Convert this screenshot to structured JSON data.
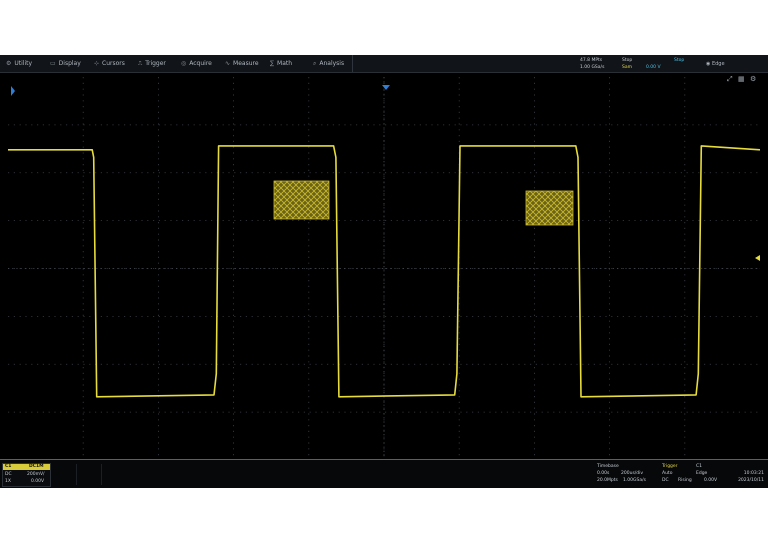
{
  "menu": {
    "items": [
      {
        "name": "menu-utility",
        "icon": "wrench-icon",
        "glyph": "⚙",
        "label": "Utility"
      },
      {
        "name": "menu-display",
        "icon": "display-icon",
        "glyph": "▭",
        "label": "Display"
      },
      {
        "name": "menu-cursors",
        "icon": "cursor-icon",
        "glyph": "⊹",
        "label": "Cursors"
      },
      {
        "name": "menu-trigger",
        "icon": "trigger-icon",
        "glyph": "⎍",
        "label": "Trigger"
      },
      {
        "name": "menu-acquire",
        "icon": "acquire-icon",
        "glyph": "◎",
        "label": "Acquire"
      },
      {
        "name": "menu-measure",
        "icon": "measure-icon",
        "glyph": "∿",
        "label": "Measure"
      },
      {
        "name": "menu-math",
        "icon": "math-icon",
        "glyph": "∑",
        "label": "Math"
      },
      {
        "name": "menu-analysis",
        "icon": "analysis-icon",
        "glyph": "⌕",
        "label": "Analysis"
      }
    ]
  },
  "status": {
    "row1_left": "47.8 MPts",
    "row1_mid": "Stop",
    "row1_right": "Stop",
    "row2_left": "1.00 GSa/s",
    "row2_mid": "Sam",
    "row2_right": "0.00 V",
    "trig_icon": "gear-icon",
    "trig_glyph": "◉",
    "trig_label": "Edge"
  },
  "ch1": {
    "label": "C1",
    "coupling": "DC1M",
    "row2_label": "DC",
    "row2_value": "200mV/",
    "row3_label": "1X",
    "row3_value": "0.00V"
  },
  "timebase": {
    "title": "Timebase",
    "delay": "0.00s",
    "scale": "200us/div",
    "srate": "1.00GSa/s",
    "points": "20.0Mpts"
  },
  "trigger": {
    "title": "Trigger",
    "source": "C1",
    "mode": "Auto",
    "coupling": "DC",
    "edge": "Edge",
    "slope": "Rising",
    "level": "0.00V"
  },
  "clock": {
    "time": "10:03:21",
    "date": "2023/10/11"
  },
  "plot_icons": {
    "icon1": "expand-icon",
    "icon1_glyph": "⤢",
    "icon2": "grid-icon",
    "icon2_glyph": "▦",
    "icon3": "settings-icon",
    "icon3_glyph": "⚙"
  },
  "colors": {
    "ch1": "#e6dc3c",
    "grid": "#3a3f45",
    "accent": "#1e6fb8"
  },
  "chart_data": {
    "type": "line",
    "series": [
      {
        "color": "#e6dc3c",
        "x": [
          0,
          0.112,
          0.114,
          0.118,
          0.274,
          0.277,
          0.28,
          0.433,
          0.436,
          0.44,
          0.594,
          0.597,
          0.601,
          0.755,
          0.758,
          0.762,
          0.915,
          0.918,
          0.922,
          1.0
        ],
        "y": [
          0.62,
          0.62,
          0.58,
          -0.67,
          -0.66,
          -0.55,
          0.64,
          0.64,
          0.58,
          -0.67,
          -0.66,
          -0.55,
          0.64,
          0.64,
          0.58,
          -0.67,
          -0.66,
          -0.55,
          0.64,
          0.62
        ]
      }
    ],
    "xlim": [
      0,
      1
    ],
    "ylim": [
      -1,
      1
    ],
    "grid": true
  }
}
